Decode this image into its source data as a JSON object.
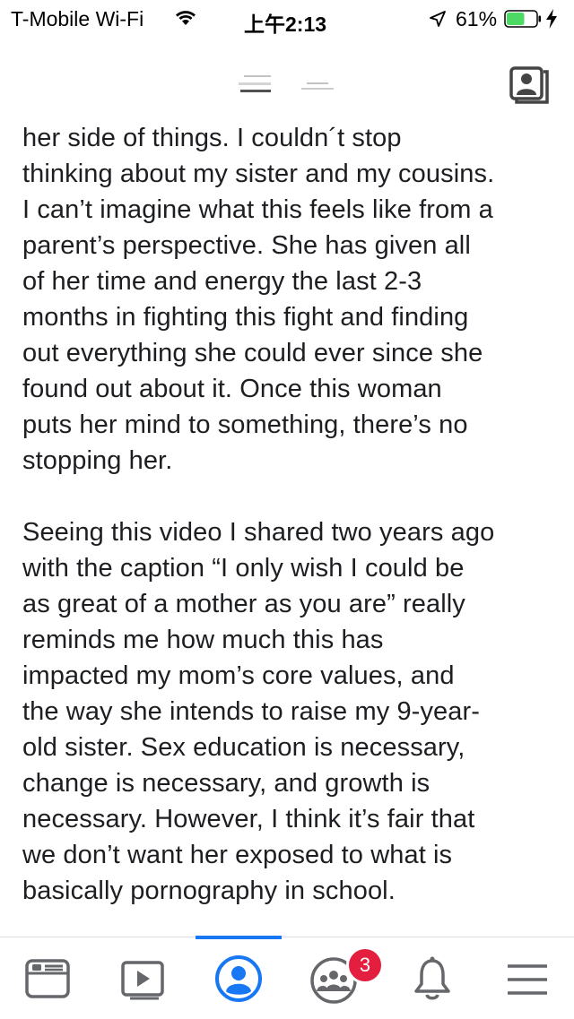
{
  "status_bar": {
    "carrier": "T-Mobile Wi-Fi",
    "time": "上午2:13",
    "battery_percent": "61%",
    "battery_level": 0.61,
    "battery_color": "#4cd964"
  },
  "nav_bar": {
    "title_redacted": true
  },
  "post": {
    "paragraph_1": "her side of things. I couldn´t stop\nthinking about my sister and my cousins.\nI can’t imagine what this feels like from a\nparent’s perspective. She has given all\nof her time and energy the last 2-3\nmonths in fighting this fight and finding\nout everything she could ever since she\nfound out about it. Once this woman\nputs her mind to something, there’s no\nstopping her.",
    "paragraph_2": "Seeing this video I shared two years ago\nwith the caption “I only wish I could be\nas great of a mother as you are” really\nreminds me how much this has\nimpacted my mom’s core values, and\nthe way she intends to raise my 9-year-\nold sister. Sex education is necessary,\nchange is necessary, and growth is\nnecessary. However, I think it’s fair that\nwe don’t want her exposed to what is\nbasically pornography in school."
  },
  "tab_bar": {
    "active_tab": "profile",
    "accent_color": "#1877f2",
    "groups_badge": "3",
    "badge_color": "#e41e3f",
    "tabs": [
      {
        "id": "news-feed",
        "icon": "news-feed-icon"
      },
      {
        "id": "watch",
        "icon": "watch-video-icon"
      },
      {
        "id": "profile",
        "icon": "profile-icon"
      },
      {
        "id": "groups",
        "icon": "groups-icon"
      },
      {
        "id": "notifications",
        "icon": "bell-icon"
      },
      {
        "id": "menu",
        "icon": "hamburger-menu-icon"
      }
    ]
  }
}
